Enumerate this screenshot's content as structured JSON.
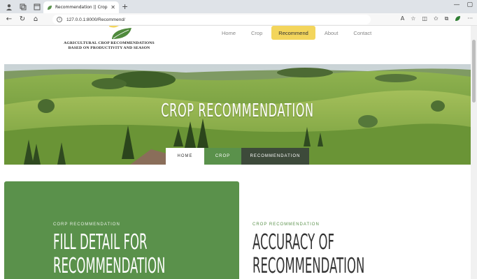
{
  "browser": {
    "tab_title": "Recommendation || Crop",
    "url": "127.0.0.1:8000/Recommend/"
  },
  "site": {
    "logo_line1": "AGRICULTURAL CROP RECOMMENDATIONS",
    "logo_line2": "BASED ON PRODUCTIVITY AND SEASON",
    "menu": [
      "Home",
      "Crop",
      "Recommend",
      "About",
      "Contact"
    ],
    "active_menu": "Recommend",
    "accent_color": "#f3d55c",
    "brand_green": "#5a914b"
  },
  "hero": {
    "title": "CROP RECOMMENDATION",
    "tabs": [
      "HOME",
      "CROP",
      "RECOMMENDATION"
    ]
  },
  "sections": {
    "left": {
      "eyebrow": "CORP RECOMMENDATION",
      "heading_line1": "FILL DETAIL FOR",
      "heading_line2": "RECOMMENDATION"
    },
    "right": {
      "eyebrow": "CROP RECOMMENDATION",
      "heading_line1": "ACCURACY OF",
      "heading_line2": "RECOMMENDATION"
    }
  }
}
